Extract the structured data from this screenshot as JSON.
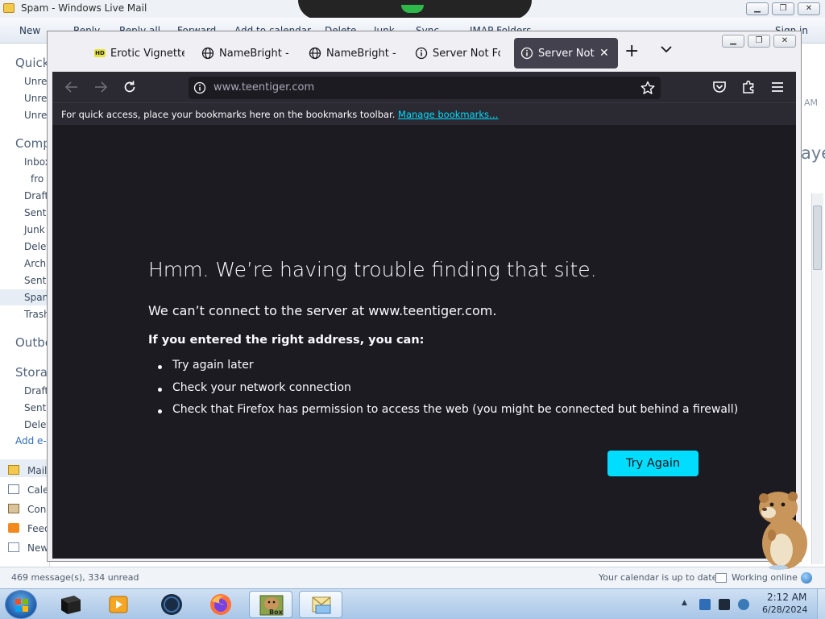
{
  "wlm": {
    "title": "Spam - Windows Live Mail",
    "ribbon": [
      "New",
      "Reply",
      "Reply all",
      "Forward",
      "Add to calendar",
      "Delete",
      "Junk",
      "Sync",
      "IMAP Folders",
      "Sign in"
    ],
    "sidebar": {
      "quick_views": "Quick",
      "quick_items": [
        "Unre",
        "Unre",
        "Unre"
      ],
      "comp": "Comp",
      "comp_items": [
        "Inbox",
        "fro",
        "Draft",
        "Sent",
        "Junk",
        "Delet",
        "Archi",
        "Sent",
        "Spam",
        "Trash"
      ],
      "outbox": "Outbo",
      "storage": "Storag",
      "storage_items": [
        "Draft",
        "Sent",
        "Delet"
      ],
      "add_email": "Add e-",
      "nav_items": [
        "Mail",
        "Cale",
        "Con",
        "Feed",
        "New"
      ]
    },
    "right_strip": {
      "am": "AM",
      "ye": "aye"
    },
    "status": {
      "messages": "469 message(s), 334 unread",
      "calendar": "Your calendar is up to date",
      "online": "Working online"
    }
  },
  "firefox": {
    "tabs": [
      {
        "label": "Erotic Vignette N",
        "icon": "hd-icon"
      },
      {
        "label": "NameBright - Do",
        "icon": "globe-icon"
      },
      {
        "label": "NameBright - Do",
        "icon": "globe-icon"
      },
      {
        "label": "Server Not Found",
        "icon": "info-icon"
      },
      {
        "label": "Server Not Fo",
        "icon": "info-icon",
        "active": true
      }
    ],
    "url": "www.teentiger.com",
    "bookmarks_hint": "For quick access, place your bookmarks here on the bookmarks toolbar.",
    "bookmarks_link": "Manage bookmarks…",
    "error": {
      "title": "Hmm. We’re having trouble finding that site.",
      "message": "We can’t connect to the server at www.teentiger.com.",
      "subtitle": "If you entered the right address, you can:",
      "suggestions": [
        "Try again later",
        "Check your network connection",
        "Check that Firefox has permission to access the web (you might be connected but behind a firewall)"
      ],
      "button": "Try Again"
    },
    "accent_color": "#00ddff"
  },
  "taskbar": {
    "apps": [
      "cube-icon",
      "media-player-icon",
      "dark-orb-icon",
      "firefox-icon",
      "hamster-box-icon",
      "windows-live-mail-icon"
    ],
    "box_label": "Box",
    "clock_time": "2:12 AM",
    "clock_date": "6/28/2024"
  }
}
